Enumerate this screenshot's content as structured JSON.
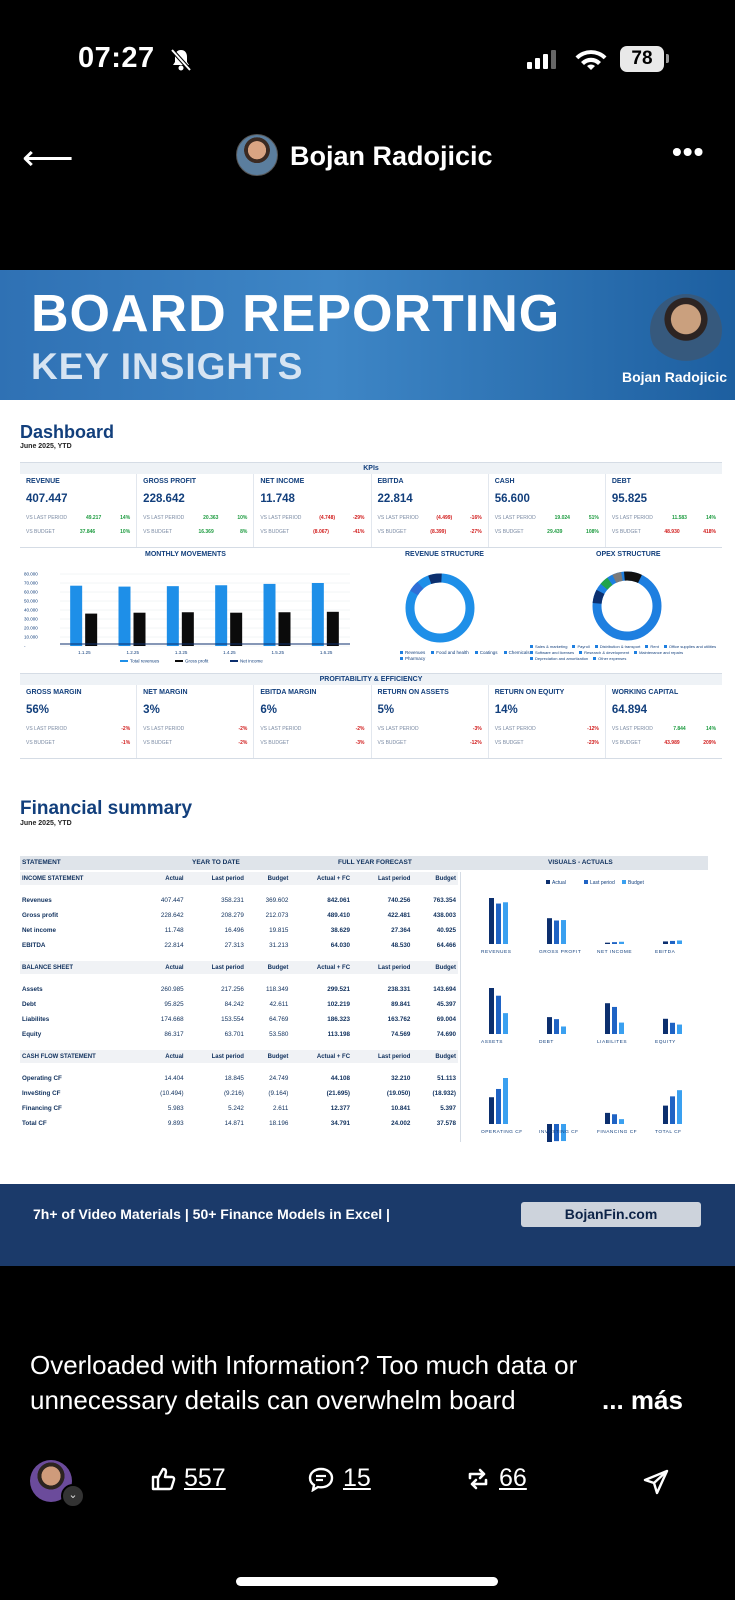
{
  "status": {
    "time": "07:27",
    "battery": "78"
  },
  "nav": {
    "author": "Bojan Radojicic",
    "more": "•••"
  },
  "banner": {
    "title": "BOARD REPORTING",
    "subtitle": "KEY INSIGHTS",
    "name": "Bojan Radojicic"
  },
  "dashboard": {
    "title": "Dashboard",
    "period": "June 2025, YTD",
    "kpis_title": "KPIs",
    "kpis": [
      {
        "name": "REVENUE",
        "value": "407.447",
        "l1": "VS LAST PERIOD",
        "v1": "49.217",
        "p1": "14%",
        "c1": "g",
        "l2": "VS BUDGET",
        "v2": "37.846",
        "p2": "10%",
        "c2": "g"
      },
      {
        "name": "GROSS PROFIT",
        "value": "228.642",
        "l1": "VS LAST PERIOD",
        "v1": "20.363",
        "p1": "10%",
        "c1": "g",
        "l2": "VS BUDGET",
        "v2": "16.369",
        "p2": "8%",
        "c2": "g"
      },
      {
        "name": "NET INCOME",
        "value": "11.748",
        "l1": "VS LAST PERIOD",
        "v1": "(4.748)",
        "p1": "-29%",
        "c1": "r",
        "l2": "VS BUDGET",
        "v2": "(8.067)",
        "p2": "-41%",
        "c2": "r"
      },
      {
        "name": "EBITDA",
        "value": "22.814",
        "l1": "VS LAST PERIOD",
        "v1": "(4.499)",
        "p1": "-16%",
        "c1": "r",
        "l2": "VS BUDGET",
        "v2": "(8.399)",
        "p2": "-27%",
        "c2": "r"
      },
      {
        "name": "CASH",
        "value": "56.600",
        "l1": "VS LAST PERIOD",
        "v1": "19.024",
        "p1": "51%",
        "c1": "g",
        "l2": "VS BUDGET",
        "v2": "29.439",
        "p2": "108%",
        "c2": "g"
      },
      {
        "name": "DEBT",
        "value": "95.825",
        "l1": "VS LAST PERIOD",
        "v1": "11.583",
        "p1": "14%",
        "c1": "g",
        "l2": "VS BUDGET",
        "v2": "48.930",
        "p2": "418%",
        "c2": "r"
      }
    ],
    "monthly_title": "MONTHLY MOVEMENTS",
    "revstruct_title": "REVENUE STRUCTURE",
    "opex_title": "OPEX STRUCTURE",
    "prof_title": "PROFITABILITY & EFFICIENCY",
    "prof": [
      {
        "name": "GROSS MARGIN",
        "value": "56%",
        "l1": "VS LAST PERIOD",
        "v1": "",
        "p1": "-2%",
        "c1": "r",
        "l2": "VS BUDGET",
        "v2": "",
        "p2": "-1%",
        "c2": "r"
      },
      {
        "name": "NET MARGIN",
        "value": "3%",
        "l1": "VS LAST PERIOD",
        "v1": "",
        "p1": "-2%",
        "c1": "r",
        "l2": "VS BUDGET",
        "v2": "",
        "p2": "-2%",
        "c2": "r"
      },
      {
        "name": "EBITDA MARGIN",
        "value": "6%",
        "l1": "VS LAST PERIOD",
        "v1": "",
        "p1": "-2%",
        "c1": "r",
        "l2": "VS BUDGET",
        "v2": "",
        "p2": "-3%",
        "c2": "r"
      },
      {
        "name": "RETURN ON ASSETS",
        "value": "5%",
        "l1": "VS LAST PERIOD",
        "v1": "",
        "p1": "-3%",
        "c1": "r",
        "l2": "VS BUDGET",
        "v2": "",
        "p2": "-12%",
        "c2": "r"
      },
      {
        "name": "RETURN ON EQUITY",
        "value": "14%",
        "l1": "VS LAST PERIOD",
        "v1": "",
        "p1": "-12%",
        "c1": "r",
        "l2": "VS BUDGET",
        "v2": "",
        "p2": "-23%",
        "c2": "r"
      },
      {
        "name": "WORKING CAPITAL",
        "value": "64.894",
        "l1": "VS LAST PERIOD",
        "v1": "7.844",
        "p1": "14%",
        "c1": "g",
        "l2": "VS BUDGET",
        "v2": "43.989",
        "p2": "209%",
        "c2": "r"
      }
    ],
    "monthly_chart": {
      "type": "bar",
      "categories": [
        "1.1.25",
        "1.2.25",
        "1.3.25",
        "1.4.25",
        "1.5.25",
        "1.6.25"
      ],
      "series": [
        {
          "name": "Total revenues",
          "values": [
            67000,
            66000,
            66500,
            67500,
            69000,
            70000
          ]
        },
        {
          "name": "Gross profit",
          "values": [
            36000,
            37000,
            37500,
            37000,
            37500,
            38000
          ]
        },
        {
          "name": "Net income",
          "values": [
            2000,
            2000,
            2000,
            2000,
            2000,
            2000
          ]
        }
      ],
      "yticks": [
        "80.000",
        "70.000",
        "60.000",
        "50.000",
        "40.000",
        "30.000",
        "20.000",
        "10.000",
        "-"
      ],
      "ylim": [
        0,
        80000
      ]
    },
    "revenue_legend": [
      "Revenues",
      "Food and health",
      "Coatings",
      "Chemicals",
      "Pharmacy"
    ],
    "opex_legend": [
      "Sales & marketing",
      "Payroll",
      "Distribution & transport",
      "Rent",
      "Office supplies and utilities",
      "Software and licenses",
      "Research & development",
      "Maintenance and repairs",
      "Depreciation and amortization",
      "Other expenses"
    ]
  },
  "financial": {
    "title": "Financial summary",
    "period": "June 2025, YTD",
    "head": {
      "statement": "STATEMENT",
      "ytd": "YEAR TO DATE",
      "fyf": "FULL YEAR FORECAST",
      "visuals": "VISUALS - ACTUALS"
    },
    "legend": [
      "Actual",
      "Last period",
      "Budget"
    ],
    "sections": [
      {
        "title": "INCOME STATEMENT",
        "cols": [
          "Actual",
          "Last period",
          "Budget",
          "Actual + FC",
          "Last period",
          "Budget"
        ],
        "rows": [
          [
            "Revenues",
            "407.447",
            "358.231",
            "369.602",
            "842.061",
            "740.256",
            "763.354"
          ],
          [
            "Gross profit",
            "228.642",
            "208.279",
            "212.073",
            "489.410",
            "422.481",
            "438.003"
          ],
          [
            "Net income",
            "11.748",
            "16.496",
            "19.815",
            "38.629",
            "27.364",
            "40.925"
          ],
          [
            "EBITDA",
            "22.814",
            "27.313",
            "31.213",
            "64.030",
            "48.530",
            "64.466"
          ]
        ]
      },
      {
        "title": "BALANCE SHEET",
        "cols": [
          "Actual",
          "Last period",
          "Budget",
          "Actual + FC",
          "Last period",
          "Budget"
        ],
        "rows": [
          [
            "Assets",
            "260.985",
            "217.256",
            "118.349",
            "299.521",
            "238.331",
            "143.694"
          ],
          [
            "Debt",
            "95.825",
            "84.242",
            "42.611",
            "102.219",
            "89.841",
            "45.397"
          ],
          [
            "Liabilites",
            "174.668",
            "153.554",
            "64.769",
            "186.323",
            "163.762",
            "69.004"
          ],
          [
            "Equity",
            "86.317",
            "63.701",
            "53.580",
            "113.198",
            "74.569",
            "74.690"
          ]
        ]
      },
      {
        "title": "CASH FLOW STATEMENT",
        "cols": [
          "Actual",
          "Last period",
          "Budget",
          "Actual + FC",
          "Last period",
          "Budget"
        ],
        "rows": [
          [
            "Operating CF",
            "14.404",
            "18.845",
            "24.749",
            "44.108",
            "32.210",
            "51.113"
          ],
          [
            "InveSting CF",
            "(10.494)",
            "(9.216)",
            "(9.164)",
            "(21.695)",
            "(19.050)",
            "(18.932)"
          ],
          [
            "Financing CF",
            "5.983",
            "5.242",
            "2.611",
            "12.377",
            "10.841",
            "5.397"
          ],
          [
            "Total CF",
            "9.893",
            "14.871",
            "18.196",
            "34.791",
            "24.002",
            "37.578"
          ]
        ]
      }
    ],
    "visual_groups": [
      {
        "labels": [
          "REVENUES",
          "GROSS PROFIT",
          "NET INCOME",
          "EBITDA"
        ],
        "values": [
          [
            407447,
            358231,
            369602
          ],
          [
            228642,
            208279,
            212073
          ],
          [
            11748,
            16496,
            19815
          ],
          [
            22814,
            27313,
            31213
          ]
        ]
      },
      {
        "labels": [
          "ASSETS",
          "DEBT",
          "LIABILITES",
          "EQUITY"
        ],
        "values": [
          [
            260985,
            217256,
            118349
          ],
          [
            95825,
            84242,
            42611
          ],
          [
            174668,
            153554,
            64769
          ],
          [
            86317,
            63701,
            53580
          ]
        ]
      },
      {
        "labels": [
          "OPERATING CF",
          "INVESTING CF",
          "FINANCING CF",
          "TOTAL CF"
        ],
        "values": [
          [
            14404,
            18845,
            24749
          ],
          [
            -10494,
            -9216,
            -9164
          ],
          [
            5983,
            5242,
            2611
          ],
          [
            9893,
            14871,
            18196
          ]
        ]
      }
    ]
  },
  "footer": {
    "text": "7h+ of Video Materials | 50+ Finance Models in Excel |",
    "site": "BojanFin.com"
  },
  "caption": {
    "line1": "Overloaded with Information? Too much data or",
    "line2": "unnecessary details can overwhelm board",
    "more": "... más"
  },
  "actions": {
    "likes": "557",
    "comments": "15",
    "reposts": "66"
  },
  "colors": {
    "dark": "#0c2f6e",
    "mid": "#1f63c4",
    "light": "#3aa0f0",
    "navy": "#123f7c"
  }
}
